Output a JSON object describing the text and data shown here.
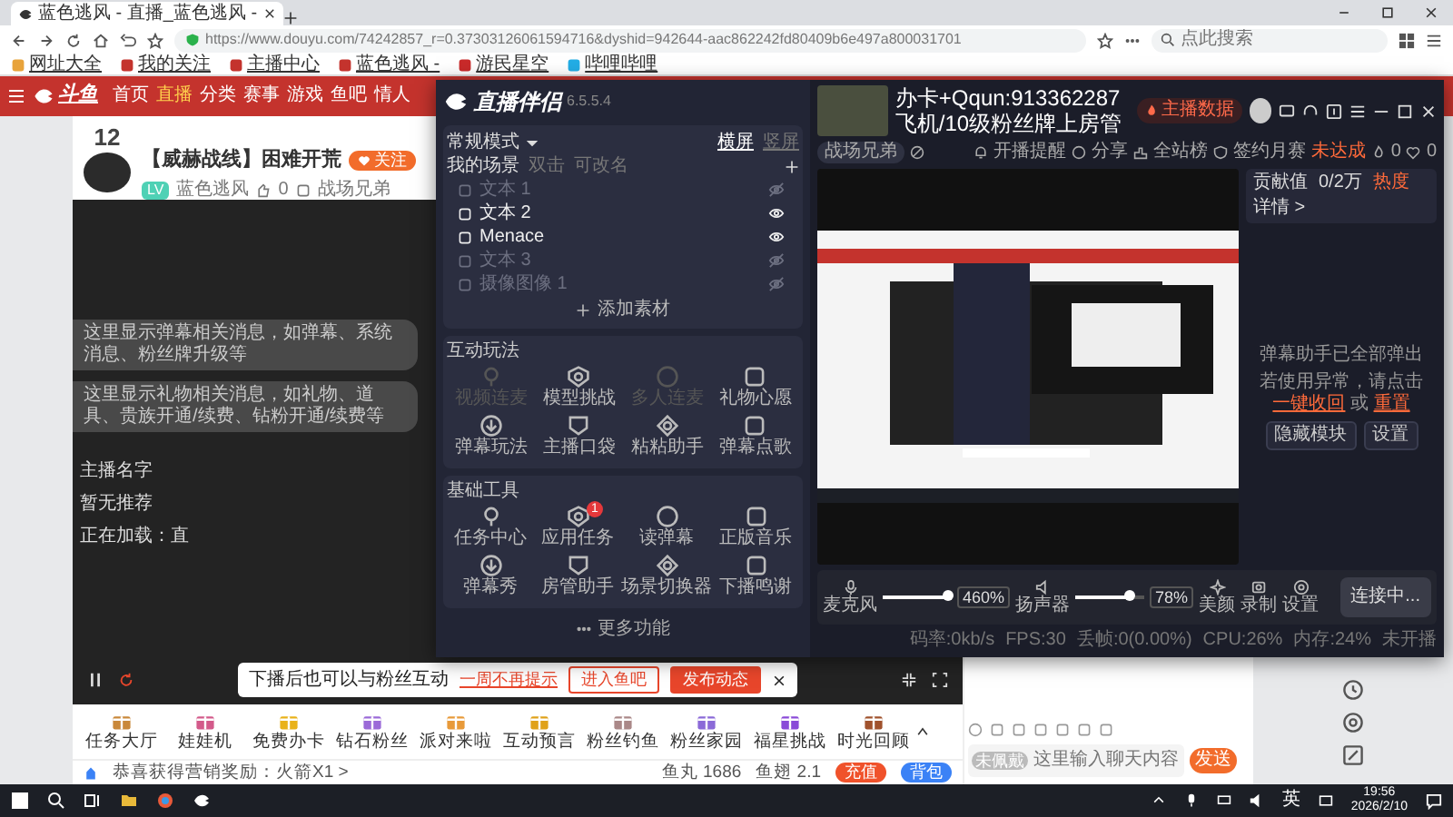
{
  "browser": {
    "tab_title": "蓝色逃风 - 直播_蓝色逃风 - ",
    "url": "https://www.douyu.com/74242857_r=0.37303126061594716&dyshid=942644-aac862242fd80409b6e497a800031701",
    "search_placeholder": "点此搜索",
    "bookmarks": [
      "网址大全",
      "我的关注",
      "主播中心",
      "蓝色逃风 -",
      "游民星空",
      "哔哩哔哩"
    ]
  },
  "site_nav": {
    "logo": "斗鱼",
    "items": [
      {
        "label": "首页",
        "selected": false
      },
      {
        "label": "直播",
        "selected": true
      },
      {
        "label": "分类",
        "selected": false
      },
      {
        "label": "赛事",
        "selected": false
      },
      {
        "label": "游戏",
        "selected": false
      },
      {
        "label": "鱼吧",
        "selected": false
      },
      {
        "label": "情人",
        "selected": false
      }
    ]
  },
  "room": {
    "rank": "12",
    "title": "【威赫战线】困难开荒",
    "follow": "关注",
    "level": "LV",
    "streamer": "蓝色逃风",
    "likes": "0",
    "team": "战场兄弟"
  },
  "video": {
    "messages": [
      "这里显示弹幕相关消息，如弹幕、系统消息、粉丝牌升级等",
      "这里显示礼物相关消息，如礼物、道具、贵族开通/续费、钻粉开通/续费等"
    ],
    "anchor_name": "主播名字",
    "recommend": "暂无推荐",
    "loading": "正在加载：直"
  },
  "prompt": {
    "text": "下播后也可以与粉丝互动",
    "dismiss": "一周不再提示",
    "buttons": [
      {
        "label": "进入鱼吧",
        "kind": "outline"
      },
      {
        "label": "发布动态",
        "kind": "solid"
      }
    ]
  },
  "gifts": [
    "任务大厅",
    "娃娃机",
    "免费办卡",
    "钻石粉丝",
    "派对来啦",
    "互动预言",
    "粉丝钓鱼",
    "粉丝家园",
    "福星挑战",
    "时光回顾"
  ],
  "footer": {
    "reward": "恭喜获得营销奖励：火箭X1 >",
    "fish_balls": "鱼丸 1686",
    "fish_fins": "鱼翅 2.1",
    "recharge": "充值",
    "backpack": "背包"
  },
  "chat": {
    "badge": "未佩戴",
    "placeholder": "这里输入聊天内容",
    "send": "发送"
  },
  "taskbar": {
    "ime": "英",
    "time": "19:56",
    "date": "2026/2/10"
  },
  "companion": {
    "name": "直播伴侣",
    "version": "6.5.5.4",
    "mode": "常规模式",
    "orientations": [
      {
        "label": "横屏",
        "selected": true
      },
      {
        "label": "竖屏",
        "selected": false
      }
    ],
    "scenes_title": "我的场景",
    "scene_hints": [
      "双击",
      "可改名"
    ],
    "sources": [
      {
        "name": "文本 1",
        "visible": false
      },
      {
        "name": "文本 2",
        "visible": true
      },
      {
        "name": "Menace",
        "visible": true
      },
      {
        "name": "文本 3",
        "visible": false
      },
      {
        "name": "摄像图像 1",
        "visible": false
      }
    ],
    "add_source": "添加素材",
    "sections": [
      {
        "title": "互动玩法",
        "tools": [
          {
            "label": "视频连麦",
            "disabled": true
          },
          {
            "label": "模型挑战",
            "disabled": false
          },
          {
            "label": "多人连麦",
            "disabled": true
          },
          {
            "label": "礼物心愿",
            "disabled": false
          },
          {
            "label": "弹幕玩法",
            "disabled": false
          },
          {
            "label": "主播口袋",
            "disabled": false
          },
          {
            "label": "粘粘助手",
            "disabled": false
          },
          {
            "label": "弹幕点歌",
            "disabled": false
          }
        ]
      },
      {
        "title": "基础工具",
        "tools": [
          {
            "label": "任务中心",
            "disabled": false
          },
          {
            "label": "应用任务",
            "disabled": false,
            "badge": "1"
          },
          {
            "label": "读弹幕",
            "disabled": false
          },
          {
            "label": "正版音乐",
            "disabled": false
          },
          {
            "label": "弹幕秀",
            "disabled": false
          },
          {
            "label": "房管助手",
            "disabled": false
          },
          {
            "label": "场景切换器",
            "disabled": false
          },
          {
            "label": "下播鸣谢",
            "disabled": false
          }
        ]
      }
    ],
    "more": "更多功能",
    "overlay_lines": [
      "办卡+Qqun:913362287",
      "飞机/10级粉丝牌上房管"
    ],
    "data_button": "主播数据",
    "category": "战场兄弟",
    "remind": "开播提醒",
    "share": "分享",
    "rank": "全站榜",
    "monthly": "签约月赛",
    "monthly_status": "未达成",
    "hot": "0",
    "hearts": "0",
    "contribution": {
      "label": "贡献值",
      "value": "0/2万",
      "heat": "热度",
      "details": "详情 >"
    },
    "assistant": {
      "title": "弹幕助手已全部弹出",
      "notice": "若使用异常，请点击",
      "links": [
        "一键收回",
        "重置"
      ],
      "joiner": "或",
      "buttons": [
        "隐藏模块",
        "设置"
      ]
    },
    "controls": {
      "mic": {
        "label": "麦克风",
        "level": 0.95,
        "reading": "460%"
      },
      "speaker": {
        "label": "扬声器",
        "level": 0.78,
        "reading": "78%"
      },
      "beauty": "美颜",
      "record": "录制",
      "settings": "设置",
      "connect": "连接中..."
    },
    "stats": [
      "码率:0kb/s",
      "FPS:30",
      "丢帧:0(0.00%)",
      "CPU:26%",
      "内存:24%",
      "未开播"
    ]
  }
}
